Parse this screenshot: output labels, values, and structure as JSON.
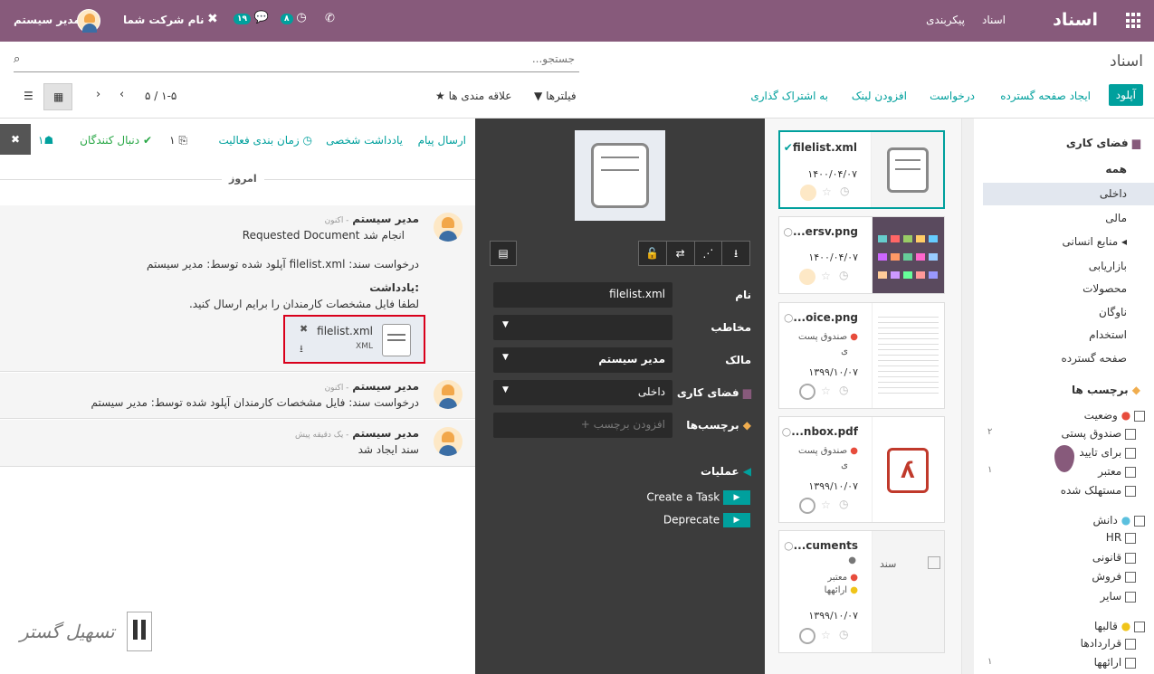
{
  "nav": {
    "app_title": "اسناد",
    "menu_documents": "اسناد",
    "menu_config": "پیکربندی",
    "company": "نام شرکت شما",
    "user": "مدیر سیستم",
    "chat_badge": "۱۹",
    "activity_badge": "۸"
  },
  "cp": {
    "breadcrumb": "اسناد",
    "search_placeholder": "جستجو...",
    "upload": "آپلود",
    "create_sheet": "ایجاد صفحه گسترده",
    "request": "درخواست",
    "add_link": "افزودن لینک",
    "share": "به اشتراک گذاری",
    "filters": "فیلترها",
    "favorites": "علاقه مندی ها",
    "pager": "۱-۵ / ۵"
  },
  "sidebar": {
    "workspace_title": "فضای کاری",
    "items": [
      "همه",
      "داخلی",
      "مالی",
      "منابع انسانی",
      "بازاریابی",
      "محصولات",
      "ناوگان",
      "استخدام",
      "صفحه گسترده"
    ],
    "tags_title": "برچسب ها",
    "status": "وضعیت",
    "status_items": [
      "صندوق پستی",
      "برای تایید",
      "معتبر",
      "مستهلک شده"
    ],
    "status_counts": [
      "۲",
      "۱"
    ],
    "knowledge": "دانش",
    "knowledge_items": [
      "HR",
      "قانونی",
      "فروش",
      "سایر"
    ],
    "templates": "قالبها",
    "templates_items": [
      "قراردادها",
      "ارائهها"
    ],
    "templates_counts": [
      "۱"
    ]
  },
  "cards": [
    {
      "name": "filelist.xml",
      "date": "۱۴۰۰/۰۴/۰۷"
    },
    {
      "name": "...ersv.png",
      "date": "۱۴۰۰/۰۴/۰۷"
    },
    {
      "name": "...oice.png",
      "tag": "صندوق پست",
      "tag2": "ی",
      "date": "۱۳۹۹/۱۰/۰۷"
    },
    {
      "name": "...nbox.pdf",
      "tag": "صندوق پست",
      "tag2": "ی",
      "date": "۱۳۹۹/۱۰/۰۷"
    },
    {
      "name": "...cuments",
      "tag": "معتبر",
      "tag2": "ارائهها",
      "date": "۱۳۹۹/۱۰/۰۷",
      "thumb": "سند"
    }
  ],
  "inspector": {
    "name_label": "نام",
    "name_value": "filelist.xml",
    "contact_label": "مخاطب",
    "owner_label": "مالک",
    "owner_value": "مدیر سیستم",
    "workspace_label": "فضای کاری",
    "workspace_value": "داخلی",
    "tags_label": "برچسب‌ها",
    "tags_placeholder": "+ افزودن برچسب",
    "actions_label": "عملیات",
    "action1": "Create a Task",
    "action2": "Deprecate"
  },
  "chatter": {
    "send_message": "ارسال پیام",
    "log_note": "یادداشت شخصی",
    "schedule": "زمان بندی فعالیت",
    "attachments_count": "۱",
    "follow": "دنبال کنندگان",
    "followers_count": "۱",
    "today": "امروز",
    "m1_author": "مدیر سیستم",
    "m1_time": "- اکنون",
    "m1_line1": "Requested Document انجام شد",
    "m1_line2": "درخواست سند: filelist.xml آپلود شده توسط: مدیر سیستم",
    "m1_note_title": "یادداشت:",
    "m1_note": "لطفا فایل مشخصات کارمندان را برایم ارسال کنید.",
    "att_name": "filelist.xml",
    "att_ext": "XML",
    "m2_author": "مدیر سیستم",
    "m2_time": "- اکنون",
    "m2_text": "درخواست سند: فایل مشخصات کارمندان آپلود شده توسط: مدیر سیستم",
    "m3_author": "مدیر سیستم",
    "m3_time": "- یک دقیقه پیش",
    "m3_text": "سند ایجاد شد"
  },
  "watermark": "تسهیل گستر",
  "colors": {
    "brand": "#875a7b",
    "accent": "#00a09d",
    "highlight": "#d9001b"
  }
}
